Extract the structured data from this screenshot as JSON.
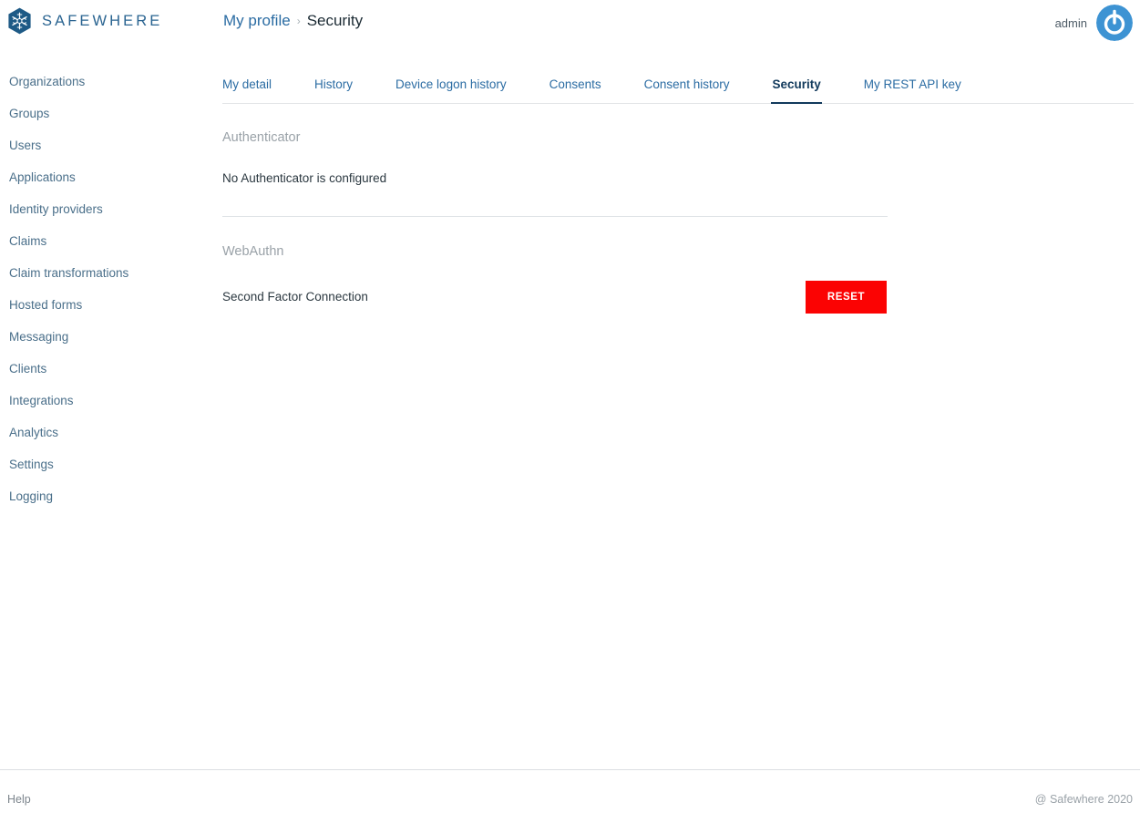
{
  "brand": {
    "name": "SAFEWHERE",
    "logo_icon": "hexagon-snowflake-icon",
    "logo_color": "#1e5a86"
  },
  "header": {
    "breadcrumb": {
      "parent": "My profile",
      "separator": "›",
      "current": "Security"
    },
    "user": {
      "name": "admin",
      "avatar_icon": "power-button-avatar-icon",
      "avatar_color": "#3d93d3"
    }
  },
  "sidebar": {
    "items": [
      {
        "label": "Organizations"
      },
      {
        "label": "Groups"
      },
      {
        "label": "Users"
      },
      {
        "label": "Applications"
      },
      {
        "label": "Identity providers"
      },
      {
        "label": "Claims"
      },
      {
        "label": "Claim transformations"
      },
      {
        "label": "Hosted forms"
      },
      {
        "label": "Messaging"
      },
      {
        "label": "Clients"
      },
      {
        "label": "Integrations"
      },
      {
        "label": "Analytics"
      },
      {
        "label": "Settings"
      },
      {
        "label": "Logging"
      }
    ]
  },
  "main": {
    "tabs": [
      {
        "label": "My detail",
        "active": false
      },
      {
        "label": "History",
        "active": false
      },
      {
        "label": "Device logon history",
        "active": false
      },
      {
        "label": "Consents",
        "active": false
      },
      {
        "label": "Consent history",
        "active": false
      },
      {
        "label": "Security",
        "active": true
      },
      {
        "label": "My REST API key",
        "active": false
      }
    ],
    "sections": {
      "authenticator": {
        "title": "Authenticator",
        "status_text": "No Authenticator is configured"
      },
      "webauthn": {
        "title": "WebAuthn",
        "row_label": "Second Factor Connection",
        "reset_button": "RESET",
        "reset_button_color": "#fb0303"
      }
    }
  },
  "footer": {
    "help_label": "Help",
    "copyright": "@ Safewhere 2020"
  }
}
